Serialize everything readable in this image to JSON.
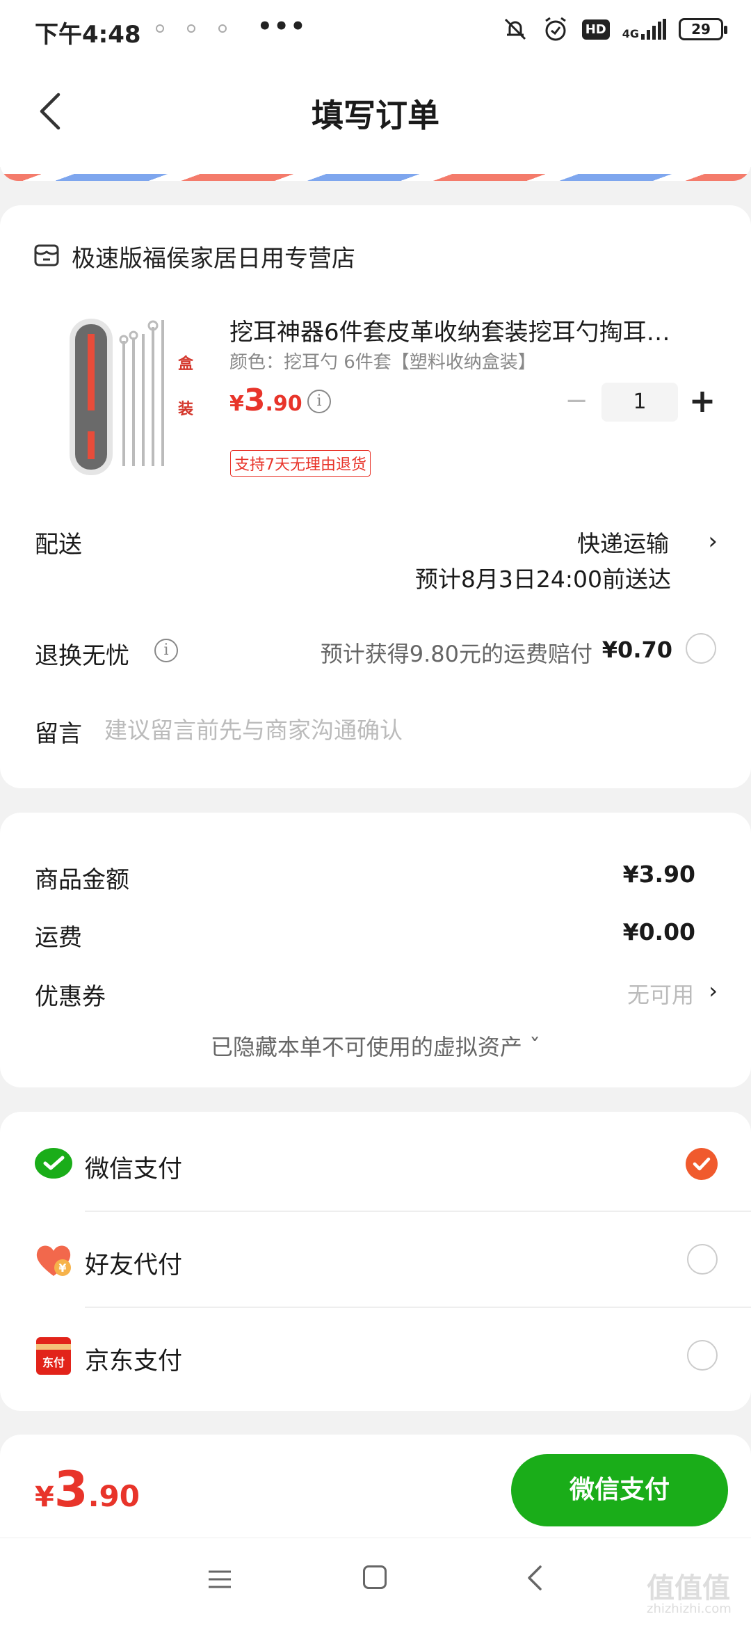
{
  "status_bar": {
    "time": "下午4:48",
    "more": "•••",
    "network": "4G",
    "hd": "HD",
    "battery": "29"
  },
  "header": {
    "title": "填写订单"
  },
  "store": {
    "name": "极速版福侯家居日用专营店"
  },
  "product": {
    "title": "挖耳神器6件套皮革收纳套装挖耳勺掏耳…",
    "spec": "颜色：挖耳勺 6件套【塑料收纳盒装】",
    "price_symbol": "¥",
    "price_int": "3",
    "price_dec": ".90",
    "quantity": "1",
    "minus": "−",
    "plus": "+",
    "badge": "支持7天无理由退货",
    "image_text_1": "盒",
    "image_text_2": "装"
  },
  "delivery": {
    "label": "配送",
    "method": "快递运输",
    "eta": "预计8月3日24:00前送达",
    "chevron": "›"
  },
  "return": {
    "label": "退换无忧",
    "desc": "预计获得9.80元的运费赔付",
    "price": "¥0.70"
  },
  "message": {
    "label": "留言",
    "placeholder": "建议留言前先与商家沟通确认"
  },
  "summary": {
    "goods_label": "商品金额",
    "goods_value": "¥3.90",
    "shipping_label": "运费",
    "shipping_value": "¥0.00",
    "coupon_label": "优惠券",
    "coupon_value": "无可用",
    "chevron": "›",
    "hidden_assets": "已隐藏本单不可使用的虚拟资产 ˇ"
  },
  "payment": {
    "methods": [
      {
        "label": "微信支付",
        "selected": true
      },
      {
        "label": "好友代付",
        "selected": false
      },
      {
        "label": "京东支付",
        "selected": false
      }
    ],
    "jd_icon_text": "东付",
    "friend_icon_text": "¥"
  },
  "footer": {
    "total_symbol": "¥",
    "total_int": "3",
    "total_dec": ".90",
    "pay_button": "微信支付"
  },
  "watermark": {
    "main": "值值值",
    "sub": "zhizhizhi.com"
  },
  "colors": {
    "accent_red": "#e8342a",
    "wechat_green": "#1aad19",
    "check_orange": "#f05a2d"
  }
}
